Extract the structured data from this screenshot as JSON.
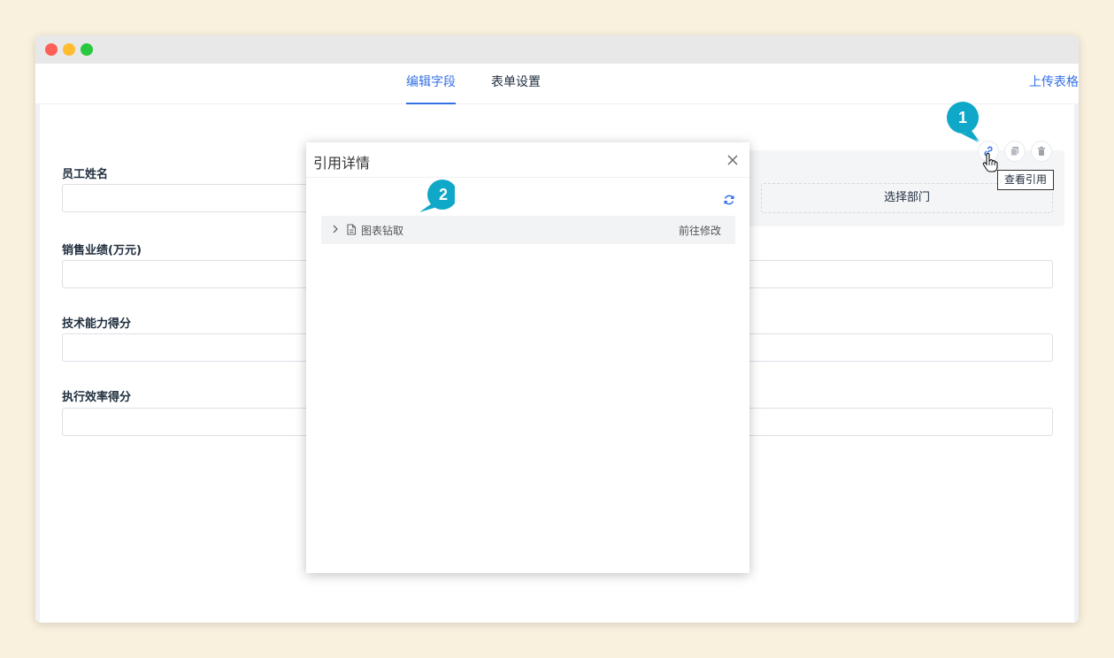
{
  "tabs": [
    {
      "label": "编辑字段",
      "active": true
    },
    {
      "label": "表单设置",
      "active": false
    }
  ],
  "header": {
    "upload_label": "上传表格"
  },
  "fields": [
    {
      "label": "员工姓名"
    },
    {
      "label": "销售业绩(万元)"
    },
    {
      "label": "技术能力得分"
    },
    {
      "label": "执行效率得分"
    }
  ],
  "department": {
    "placeholder": "选择部门"
  },
  "actions": {
    "tooltip": "查看引用"
  },
  "badges": [
    "1",
    "2"
  ],
  "dialog": {
    "title": "引用详情",
    "rows": [
      {
        "name": "图表钻取",
        "action": "前往修改"
      }
    ]
  },
  "colors": {
    "accent": "#3370e6",
    "badge": "#10a8c8"
  }
}
